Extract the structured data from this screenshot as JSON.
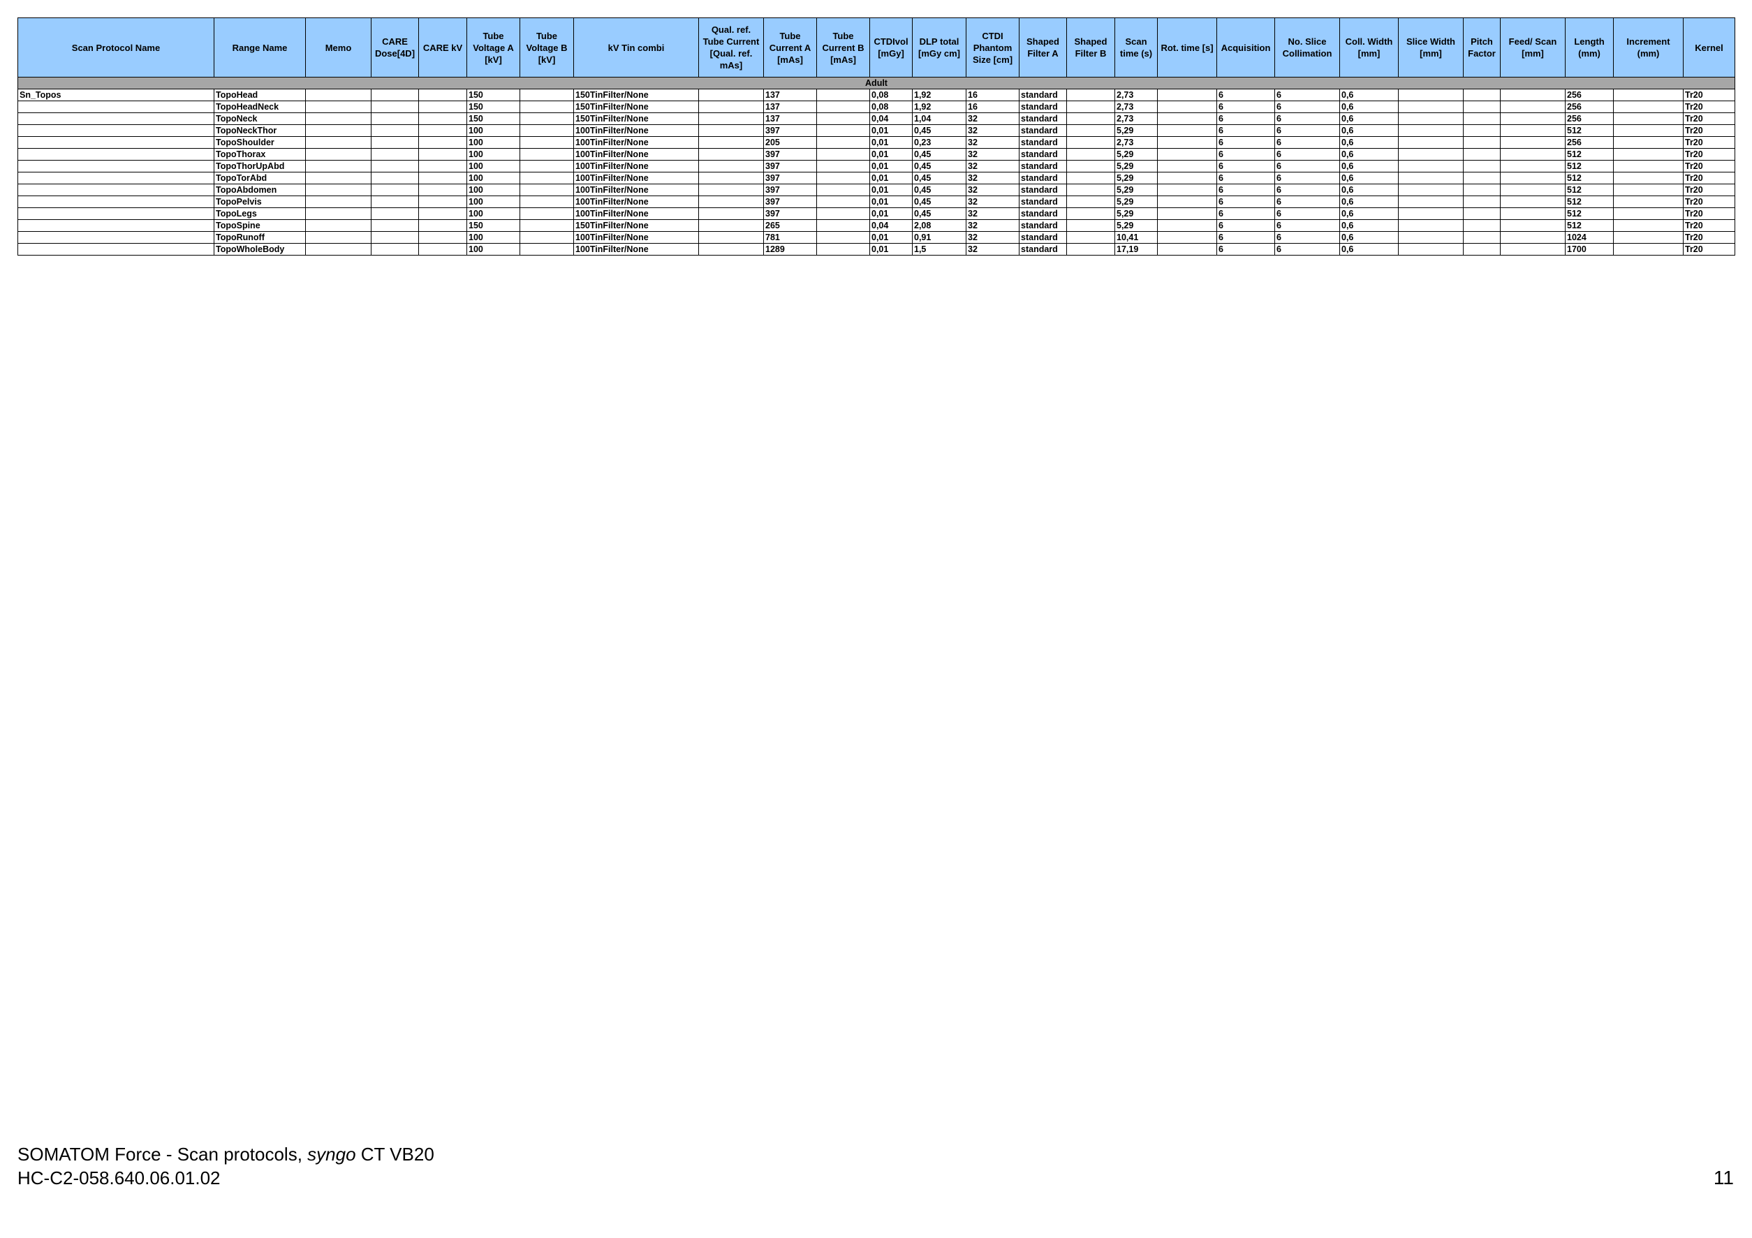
{
  "table": {
    "columns": [
      {
        "key": "protocol",
        "label": "Scan Protocol Name"
      },
      {
        "key": "range",
        "label": "Range Name"
      },
      {
        "key": "memo",
        "label": "Memo"
      },
      {
        "key": "care_dose",
        "label": "CARE Dose[4D]"
      },
      {
        "key": "care_kv",
        "label": "CARE kV"
      },
      {
        "key": "tube_va",
        "label": "Tube Voltage A [kV]"
      },
      {
        "key": "tube_vb",
        "label": "Tube Voltage B [kV]"
      },
      {
        "key": "kv_tin",
        "label": "kV Tin combi"
      },
      {
        "key": "qual_ref",
        "label": "Qual. ref. Tube Current [Qual. ref. mAs]"
      },
      {
        "key": "tube_ca",
        "label": "Tube Current A [mAs]"
      },
      {
        "key": "tube_cb",
        "label": "Tube Current B [mAs]"
      },
      {
        "key": "ctdivol",
        "label": "CTDIvol [mGy]"
      },
      {
        "key": "dlp",
        "label": "DLP total [mGy cm]"
      },
      {
        "key": "ctdi_phantom",
        "label": "CTDI Phantom Size [cm]"
      },
      {
        "key": "filter_a",
        "label": "Shaped Filter A"
      },
      {
        "key": "filter_b",
        "label": "Shaped Filter B"
      },
      {
        "key": "scan_time",
        "label": "Scan time (s)"
      },
      {
        "key": "rot_time",
        "label": "Rot. time [s]"
      },
      {
        "key": "acquisition",
        "label": "Acquisition"
      },
      {
        "key": "no_slice",
        "label": "No. Slice Collimation"
      },
      {
        "key": "coll_width",
        "label": "Coll. Width [mm]"
      },
      {
        "key": "slice_width",
        "label": "Slice Width [mm]"
      },
      {
        "key": "pitch",
        "label": "Pitch Factor"
      },
      {
        "key": "feed",
        "label": "Feed/ Scan [mm]"
      },
      {
        "key": "length",
        "label": "Length (mm)"
      },
      {
        "key": "increment",
        "label": "Increment (mm)"
      },
      {
        "key": "kernel",
        "label": "Kernel"
      }
    ],
    "group_label": "Adult",
    "rows": [
      [
        "Sn_Topos",
        "TopoHead",
        "",
        "",
        "",
        "150",
        "",
        "150TinFilter/None",
        "",
        "137",
        "",
        "0,08",
        "1,92",
        "16",
        "standard",
        "",
        "2,73",
        "",
        "6",
        "6",
        "0,6",
        "",
        "",
        "",
        "256",
        "",
        "Tr20"
      ],
      [
        "",
        "TopoHeadNeck",
        "",
        "",
        "",
        "150",
        "",
        "150TinFilter/None",
        "",
        "137",
        "",
        "0,08",
        "1,92",
        "16",
        "standard",
        "",
        "2,73",
        "",
        "6",
        "6",
        "0,6",
        "",
        "",
        "",
        "256",
        "",
        "Tr20"
      ],
      [
        "",
        "TopoNeck",
        "",
        "",
        "",
        "150",
        "",
        "150TinFilter/None",
        "",
        "137",
        "",
        "0,04",
        "1,04",
        "32",
        "standard",
        "",
        "2,73",
        "",
        "6",
        "6",
        "0,6",
        "",
        "",
        "",
        "256",
        "",
        "Tr20"
      ],
      [
        "",
        "TopoNeckThor",
        "",
        "",
        "",
        "100",
        "",
        "100TinFilter/None",
        "",
        "397",
        "",
        "0,01",
        "0,45",
        "32",
        "standard",
        "",
        "5,29",
        "",
        "6",
        "6",
        "0,6",
        "",
        "",
        "",
        "512",
        "",
        "Tr20"
      ],
      [
        "",
        "TopoShoulder",
        "",
        "",
        "",
        "100",
        "",
        "100TinFilter/None",
        "",
        "205",
        "",
        "0,01",
        "0,23",
        "32",
        "standard",
        "",
        "2,73",
        "",
        "6",
        "6",
        "0,6",
        "",
        "",
        "",
        "256",
        "",
        "Tr20"
      ],
      [
        "",
        "TopoThorax",
        "",
        "",
        "",
        "100",
        "",
        "100TinFilter/None",
        "",
        "397",
        "",
        "0,01",
        "0,45",
        "32",
        "standard",
        "",
        "5,29",
        "",
        "6",
        "6",
        "0,6",
        "",
        "",
        "",
        "512",
        "",
        "Tr20"
      ],
      [
        "",
        "TopoThorUpAbd",
        "",
        "",
        "",
        "100",
        "",
        "100TinFilter/None",
        "",
        "397",
        "",
        "0,01",
        "0,45",
        "32",
        "standard",
        "",
        "5,29",
        "",
        "6",
        "6",
        "0,6",
        "",
        "",
        "",
        "512",
        "",
        "Tr20"
      ],
      [
        "",
        "TopoTorAbd",
        "",
        "",
        "",
        "100",
        "",
        "100TinFilter/None",
        "",
        "397",
        "",
        "0,01",
        "0,45",
        "32",
        "standard",
        "",
        "5,29",
        "",
        "6",
        "6",
        "0,6",
        "",
        "",
        "",
        "512",
        "",
        "Tr20"
      ],
      [
        "",
        "TopoAbdomen",
        "",
        "",
        "",
        "100",
        "",
        "100TinFilter/None",
        "",
        "397",
        "",
        "0,01",
        "0,45",
        "32",
        "standard",
        "",
        "5,29",
        "",
        "6",
        "6",
        "0,6",
        "",
        "",
        "",
        "512",
        "",
        "Tr20"
      ],
      [
        "",
        "TopoPelvis",
        "",
        "",
        "",
        "100",
        "",
        "100TinFilter/None",
        "",
        "397",
        "",
        "0,01",
        "0,45",
        "32",
        "standard",
        "",
        "5,29",
        "",
        "6",
        "6",
        "0,6",
        "",
        "",
        "",
        "512",
        "",
        "Tr20"
      ],
      [
        "",
        "TopoLegs",
        "",
        "",
        "",
        "100",
        "",
        "100TinFilter/None",
        "",
        "397",
        "",
        "0,01",
        "0,45",
        "32",
        "standard",
        "",
        "5,29",
        "",
        "6",
        "6",
        "0,6",
        "",
        "",
        "",
        "512",
        "",
        "Tr20"
      ],
      [
        "",
        "TopoSpine",
        "",
        "",
        "",
        "150",
        "",
        "150TinFilter/None",
        "",
        "265",
        "",
        "0,04",
        "2,08",
        "32",
        "standard",
        "",
        "5,29",
        "",
        "6",
        "6",
        "0,6",
        "",
        "",
        "",
        "512",
        "",
        "Tr20"
      ],
      [
        "",
        "TopoRunoff",
        "",
        "",
        "",
        "100",
        "",
        "100TinFilter/None",
        "",
        "781",
        "",
        "0,01",
        "0,91",
        "32",
        "standard",
        "",
        "10,41",
        "",
        "6",
        "6",
        "0,6",
        "",
        "",
        "",
        "1024",
        "",
        "Tr20"
      ],
      [
        "",
        "TopoWholeBody",
        "",
        "",
        "",
        "100",
        "",
        "100TinFilter/None",
        "",
        "1289",
        "",
        "0,01",
        "1,5",
        "32",
        "standard",
        "",
        "17,19",
        "",
        "6",
        "6",
        "0,6",
        "",
        "",
        "",
        "1700",
        "",
        "Tr20"
      ]
    ]
  },
  "footer": {
    "title_prefix": "SOMATOM Force - Scan protocols, ",
    "title_italic": "syngo",
    "title_suffix": " CT VB20",
    "doc_number": "HC-C2-058.640.06.01.02",
    "page_number": "11"
  }
}
